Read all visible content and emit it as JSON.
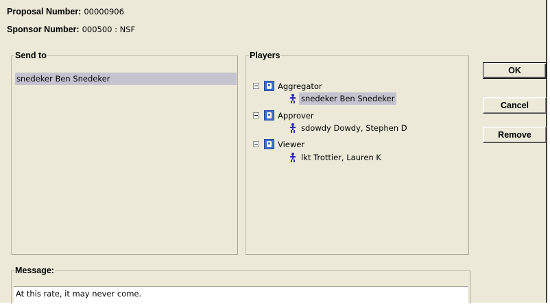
{
  "proposal": {
    "label": "Proposal Number:",
    "value": "00000906"
  },
  "sponsor": {
    "label": "Sponsor Number:",
    "value": "000500 : NSF"
  },
  "send_to": {
    "title": "Send to",
    "items": [
      {
        "text": "snedeker  Ben Snedeker",
        "selected": true
      }
    ]
  },
  "players": {
    "title": "Players",
    "roles": [
      {
        "name": "Aggregator",
        "icon": "role-icon",
        "players": [
          {
            "text": "snedeker  Ben Snedeker",
            "selected": true
          }
        ]
      },
      {
        "name": "Approver",
        "icon": "role-icon",
        "players": [
          {
            "text": "sdowdy  Dowdy, Stephen D",
            "selected": false
          }
        ]
      },
      {
        "name": "Viewer",
        "icon": "role-icon",
        "players": [
          {
            "text": "lkt  Trottier, Lauren K",
            "selected": false
          }
        ]
      }
    ]
  },
  "buttons": {
    "ok": "OK",
    "cancel": "Cancel",
    "remove": "Remove"
  },
  "message": {
    "title": "Message:",
    "text": "At this rate, it may never come."
  },
  "colors": {
    "dialog_bg": "#ece9d8",
    "selection": "#c5c3cf",
    "role_icon": "#3f6fd1",
    "person_icon": "#2c2ca8"
  }
}
